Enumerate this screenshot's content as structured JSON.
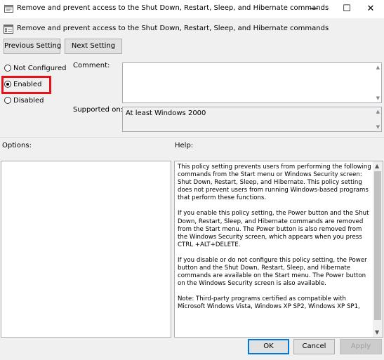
{
  "window": {
    "title": "Remove and prevent access to the Shut Down, Restart, Sleep, and Hibernate commands",
    "minimize_glyph": "—",
    "maximize_glyph": "☐",
    "close_glyph": "✕"
  },
  "header": {
    "policy_name": "Remove and prevent access to the Shut Down, Restart, Sleep, and Hibernate commands",
    "icon": "policy-setting-icon"
  },
  "nav": {
    "previous_label": "Previous Setting",
    "next_label": "Next Setting"
  },
  "state": {
    "options": [
      {
        "label": "Not Configured",
        "checked": false
      },
      {
        "label": "Enabled",
        "checked": true
      },
      {
        "label": "Disabled",
        "checked": false
      }
    ],
    "highlight_color": "#e8121b"
  },
  "comment": {
    "label": "Comment:",
    "value": ""
  },
  "supported": {
    "label": "Supported on:",
    "value": "At least Windows 2000"
  },
  "options_label": "Options:",
  "help": {
    "label": "Help:",
    "paragraphs": [
      "This policy setting prevents users from performing the following commands from the Start menu or Windows Security screen: Shut Down, Restart, Sleep, and Hibernate. This policy setting does not prevent users from running Windows-based programs that perform these functions.",
      "If you enable this policy setting, the Power button and the Shut Down, Restart, Sleep, and Hibernate commands are removed from the Start menu. The Power button is also removed from the Windows Security screen, which appears when you press CTRL +ALT+DELETE.",
      "If you disable or do not configure this policy setting, the Power button and the Shut Down, Restart, Sleep, and Hibernate commands are available on the Start menu. The Power button on the Windows Security screen is also available.",
      "Note: Third-party programs certified as compatible with Microsoft Windows Vista, Windows XP SP2, Windows XP SP1,"
    ]
  },
  "footer": {
    "ok_label": "OK",
    "cancel_label": "Cancel",
    "apply_label": "Apply"
  }
}
